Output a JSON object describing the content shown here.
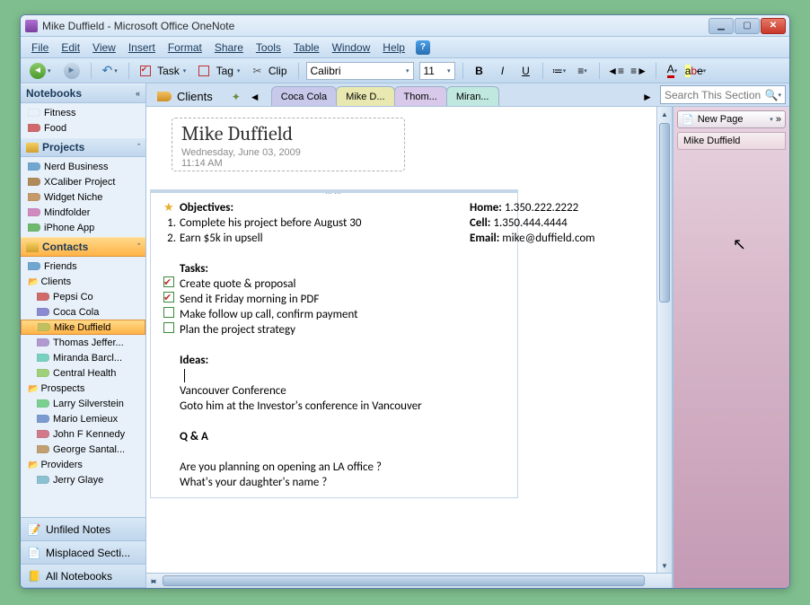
{
  "window": {
    "title": "Mike Duffield - Microsoft Office OneNote"
  },
  "menu": {
    "file": "File",
    "edit": "Edit",
    "view": "View",
    "insert": "Insert",
    "format": "Format",
    "share": "Share",
    "tools": "Tools",
    "table": "Table",
    "window": "Window",
    "help": "Help"
  },
  "toolbar": {
    "task": "Task",
    "tag": "Tag",
    "clip": "Clip",
    "font": "Calibri",
    "size": "11",
    "bold": "B",
    "italic": "I",
    "underline": "U",
    "fontcolor": "A",
    "highlight": "a"
  },
  "sidebar": {
    "header_notebooks": "Notebooks",
    "top": {
      "item0": "Fitness",
      "item1": "Food"
    },
    "projects_hdr": "Projects",
    "projects": {
      "item0": "Nerd Business",
      "item1": "XCaliber Project",
      "item2": "Widget Niche",
      "item3": "Mindfolder",
      "item4": "iPhone App"
    },
    "contacts_hdr": "Contacts",
    "contacts": {
      "friends": "Friends",
      "clients": "Clients",
      "c0": "Pepsi Co",
      "c1": "Coca Cola",
      "c2": "Mike Duffield",
      "c3": "Thomas Jeffer...",
      "c4": "Miranda Barcl...",
      "c5": "Central Health",
      "prospects": "Prospects",
      "p0": "Larry Silverstein",
      "p1": "Mario Lemieux",
      "p2": "John F Kennedy",
      "p3": "George Santal...",
      "providers": "Providers",
      "pr0": "Jerry Glaye"
    },
    "unfiled": "Unfiled Notes",
    "misplaced": "Misplaced Secti...",
    "all": "All Notebooks",
    "colors": {
      "fitness": "#6fb96f",
      "food": "#d06a6a",
      "nerd": "#6fa7d0",
      "xcal": "#b08a5a",
      "widget": "#c49a6a",
      "mind": "#d08ac0",
      "iphone": "#6fb96f",
      "friends": "#6fa7d0",
      "pepsi": "#d06a6a",
      "coca": "#8a8ad0",
      "mike": "#c0c060",
      "thomas": "#b09ad0",
      "miranda": "#7ad0c0",
      "central": "#a0d07a",
      "larry": "#7ad090",
      "mario": "#7a9ad0",
      "john": "#d07a8a",
      "george": "#c0a070",
      "jerry": "#8ac0d0"
    }
  },
  "section": {
    "label": "Clients",
    "tabs": {
      "t0": "Coca Cola",
      "t1": "Mike D...",
      "t2": "Thom...",
      "t3": "Miran..."
    },
    "tab_colors": {
      "t0": "#c8c8ea",
      "t1": "#e8e8b0",
      "t2": "#d8c8ea",
      "t3": "#c0e8de"
    }
  },
  "search": {
    "placeholder": "Search This Section"
  },
  "page": {
    "title": "Mike Duffield",
    "date": "Wednesday, June 03, 2009",
    "time": "11:14 AM",
    "objectives_hdr": "Objectives:",
    "obj1_num": "1.",
    "obj1": "Complete his project before August 30",
    "obj2_num": "2.",
    "obj2": "Earn $5k in upsell",
    "tasks_hdr": "Tasks:",
    "task1": "Create quote & proposal",
    "task2": "Send it Friday morning in PDF",
    "task3": "Make follow up call, confirm payment",
    "task4": "Plan the project strategy",
    "ideas_hdr": "Ideas:",
    "idea1": "Vancouver Conference",
    "idea2": "Goto him at the Investor's conference in Vancouver",
    "qa_hdr": "Q & A",
    "qa1": "Are you planning on opening an LA office ?",
    "qa2": "What's your daughter's name ?",
    "contact": {
      "home_lbl": "Home:",
      "home": "1.350.222.2222",
      "cell_lbl": "Cell:",
      "cell": "1.350.444.4444",
      "email_lbl": "Email:",
      "email": "mike@duffield.com"
    }
  },
  "pagelist": {
    "newpage": "New Page",
    "p0": "Mike Duffield"
  }
}
